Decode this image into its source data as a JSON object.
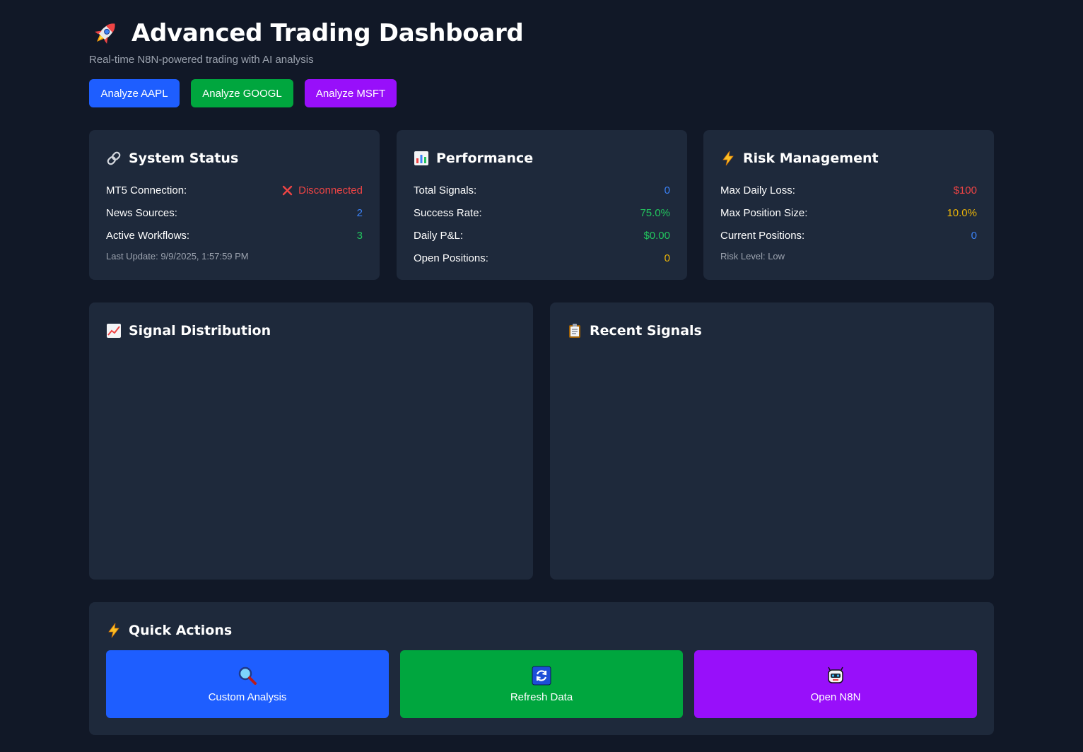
{
  "header": {
    "title": "Advanced Trading Dashboard",
    "subtitle": "Real-time N8N-powered trading with AI analysis",
    "buttons": [
      "Analyze AAPL",
      "Analyze GOOGL",
      "Analyze MSFT"
    ]
  },
  "system_status": {
    "title": "System Status",
    "rows": [
      {
        "label": "MT5 Connection:",
        "value": "Disconnected"
      },
      {
        "label": "News Sources:",
        "value": "2"
      },
      {
        "label": "Active Workflows:",
        "value": "3"
      }
    ],
    "footer": "Last Update: 9/9/2025, 1:57:59 PM"
  },
  "performance": {
    "title": "Performance",
    "rows": [
      {
        "label": "Total Signals:",
        "value": "0"
      },
      {
        "label": "Success Rate:",
        "value": "75.0%"
      },
      {
        "label": "Daily P&L:",
        "value": "$0.00"
      },
      {
        "label": "Open Positions:",
        "value": "0"
      }
    ]
  },
  "risk": {
    "title": "Risk Management",
    "rows": [
      {
        "label": "Max Daily Loss:",
        "value": "$100"
      },
      {
        "label": "Max Position Size:",
        "value": "10.0%"
      },
      {
        "label": "Current Positions:",
        "value": "0"
      }
    ],
    "footer": "Risk Level: Low"
  },
  "signal_distribution": {
    "title": "Signal Distribution"
  },
  "recent_signals": {
    "title": "Recent Signals"
  },
  "quick_actions": {
    "title": "Quick Actions",
    "buttons": [
      "Custom Analysis",
      "Refresh Data",
      "Open N8N"
    ]
  },
  "colors": {
    "background": "#111827",
    "card": "#1e293b",
    "blue": "#1e5eff",
    "green": "#00a63e",
    "purple": "#980ffa",
    "status_red": "#ef4444",
    "value_blue": "#3b82f6",
    "value_green": "#22c55e",
    "value_yellow": "#eab308"
  },
  "icons": {
    "title": "rocket-icon",
    "system_status": "link-icon",
    "performance": "bar-chart-icon",
    "risk": "lightning-icon",
    "signal_distribution": "line-chart-icon",
    "recent_signals": "clipboard-icon",
    "quick_actions": "lightning-icon",
    "custom_analysis": "magnifier-icon",
    "refresh_data": "refresh-icon",
    "open_n8n": "robot-icon"
  }
}
